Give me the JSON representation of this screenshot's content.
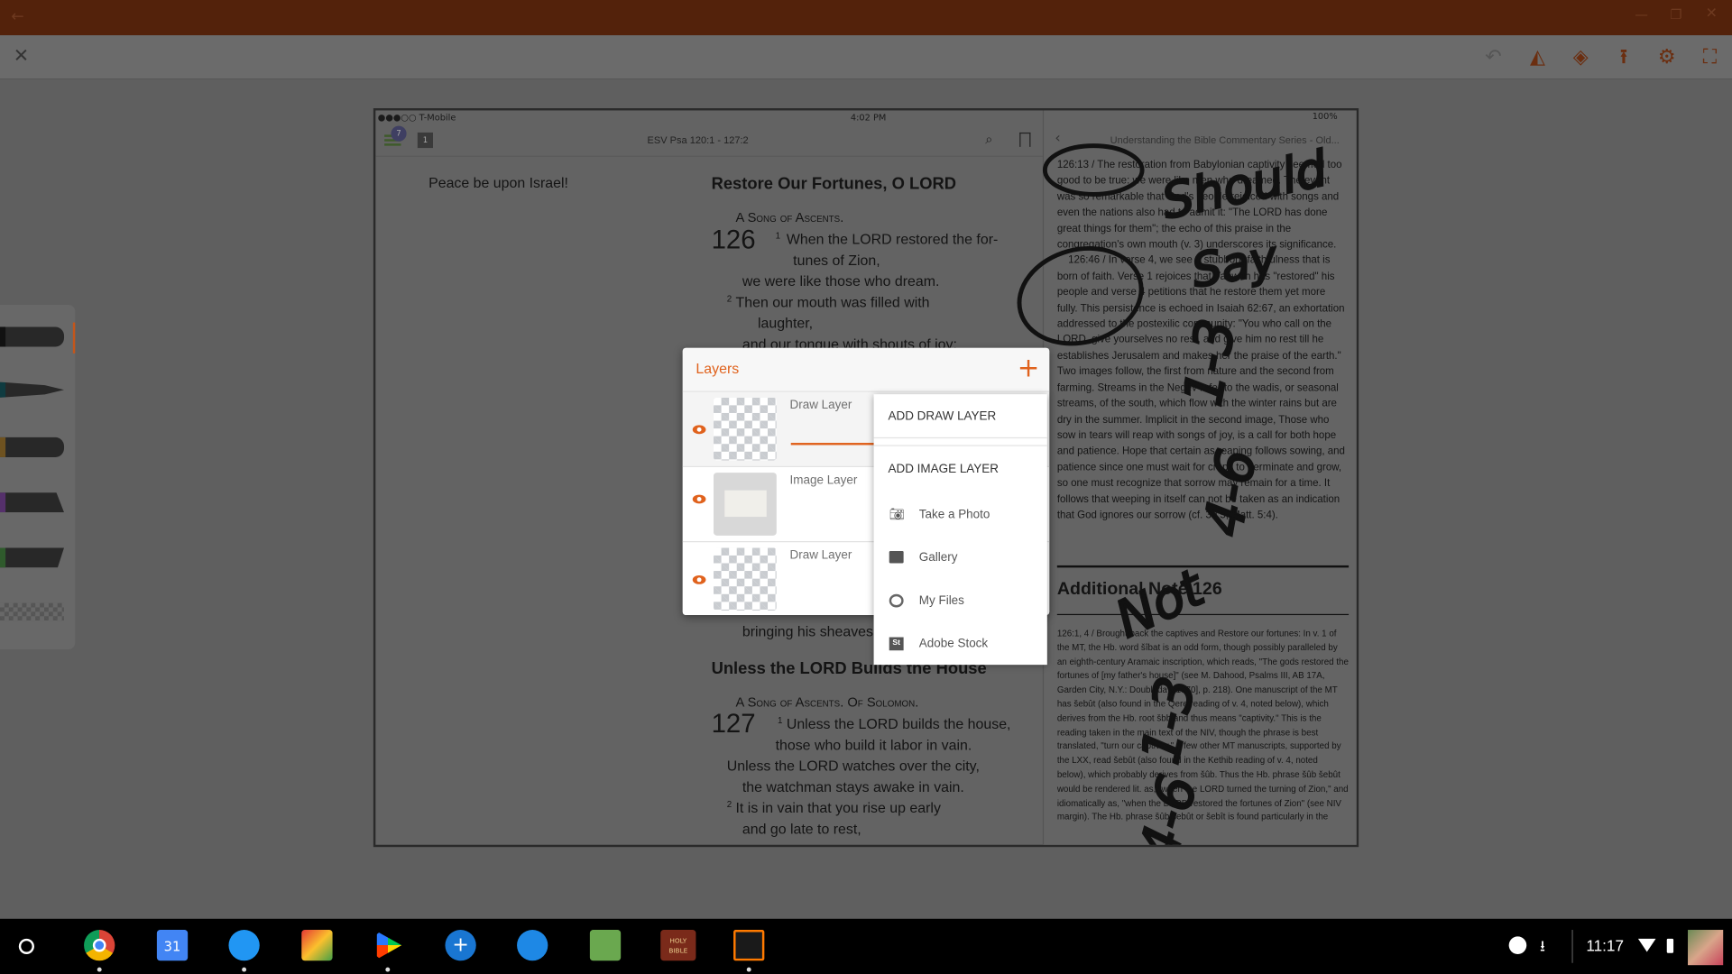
{
  "colors": {
    "accent": "#e0621d",
    "titlebar": "#53220b",
    "toolbar_icons": "#6b2e10",
    "taskbar": "#000000"
  },
  "titlebar": {
    "back_icon": "arrow-left",
    "controls": [
      "minimize",
      "restore",
      "close"
    ]
  },
  "toolbar": {
    "close_icon": "close",
    "icons": [
      "undo",
      "shapes",
      "layers",
      "upload",
      "settings",
      "fullscreen"
    ]
  },
  "screenshot": {
    "status": {
      "carrier": "●●●○○ T-Mobile",
      "time": "4:02 PM",
      "battery": "100%"
    },
    "left_header": {
      "badge": "7",
      "tab_number": "1",
      "reference": "ESV Psa 120:1 - 127:2"
    },
    "right_header": {
      "title": "Understanding the Bible Commentary Series - Old..."
    },
    "bible": {
      "prev_line": "Peace be upon Israel!",
      "heading1": "Restore Our Fortunes, O LORD",
      "song1": "A Song of Ascents.",
      "chapter1": "126",
      "lines1": [
        "When the LORD restored the for-",
        "tunes of Zion,",
        "we were like those who dream.",
        "Then our mouth was filled with",
        "laughter,",
        "and our tongue with shouts of joy;"
      ],
      "verse_nums1": [
        "1",
        "2"
      ],
      "line_bringing": "bringing his sheaves with him.",
      "heading2": "Unless the LORD Builds the House",
      "song2": "A Song of Ascents. Of Solomon.",
      "chapter2": "127",
      "lines2": [
        "Unless the LORD builds the house,",
        "those who build it labor in vain.",
        "Unless the LORD watches over the city,",
        "the watchman stays awake in vain.",
        "It is in vain that you rise up early",
        "and go late to rest,"
      ],
      "verse_nums2": [
        "1",
        "2"
      ]
    },
    "commentary": {
      "para1": "126:13 / The restoration from Babylonian captivity seemed too good to be true: we were like men who dreamed. The event was so remarkable that God's people rejoiced with songs and even the nations also had to admit it: \"The LORD has done great things for them\"; the echo of this praise in the congregation's own mouth (v. 3) underscores its significance.",
      "para2": "126:46 / In verse 4, we see a stubborn faithfulness that is born of faith. Verse 1 rejoices that Yahweh has \"restored\" his people and verse 4 petitions that he restore them yet more fully. This persistence is echoed in Isaiah 62:67, an exhortation addressed to the postexilic community: \"You who call on the LORD, give yourselves no rest, and give him no rest till he establishes Jerusalem and makes her the praise of the earth.\" Two images follow, the first from nature and the second from farming. Streams in the Negev refer to the wadis, or seasonal streams, of the south, which flow with the winter rains but are dry in the summer. Implicit in the second image, Those who sow in tears will reap with songs of joy, is a call for both hope and patience. Hope that certain as reaping follows sowing, and patience since one must wait for crops to germinate and grow, so one must recognize that sorrow may remain for a time. It follows that weeping in itself can not be taken as an indication that God ignores our sorrow (cf. 30:5; Matt. 5:4).",
      "note_heading": "Additional Note 126",
      "note": "126:1, 4 / Brought back the captives and Restore our fortunes: In v. 1 of the MT, the Hb. word šîbat is an odd form, though possibly paralleled by an eighth-century Aramaic inscription, which reads, \"The gods restored the fortunes of [my father's house]\" (see M. Dahood, Psalms III, AB 17A, Garden City, N.Y.: Doubleday, 1970], p. 218). One manuscript of the MT has šebût (also found in the Qere reading of v. 4, noted below), which derives from the Hb. root šbb and thus means \"captivity.\" This is the reading taken in the main text of the NIV, though the phrase is best translated, \"turn our captivity.\" A few other MT manuscripts, supported by the LXX, read šebût (also found in the Kethib reading of v. 4, noted below), which probably derives from šûb. Thus the Hb. phrase šûb šebût would be rendered lit. as, \"when the LORD turned the turning of Zion,\" and idiomatically as, \"when the LORD restored the fortunes of Zion\" (see NIV margin). The Hb. phrase šûb šebût or šebît is found particularly in the"
    },
    "handwriting": [
      "Should",
      "Say",
      "1-3",
      "4-6",
      "Not",
      "1-3",
      "4-6"
    ]
  },
  "brush_colors": [
    "#111111",
    "#0f3b40",
    "#6e5220",
    "#55306b",
    "#2f5a2c"
  ],
  "layers_panel": {
    "title": "Layers",
    "add_icon": "plus",
    "layers": [
      {
        "name": "Draw Layer",
        "visible": true,
        "selected": true
      },
      {
        "name": "Image Layer",
        "visible": true,
        "selected": false
      },
      {
        "name": "Draw Layer",
        "visible": true,
        "selected": false
      }
    ]
  },
  "add_menu": {
    "add_draw": "ADD DRAW LAYER",
    "add_image": "ADD IMAGE LAYER",
    "items": [
      {
        "label": "Take a Photo",
        "icon": "camera"
      },
      {
        "label": "Gallery",
        "icon": "gallery"
      },
      {
        "label": "My Files",
        "icon": "creative-cloud"
      },
      {
        "label": "Adobe Stock",
        "icon": "adobe-stock",
        "glyph": "St"
      }
    ]
  },
  "taskbar": {
    "apps": [
      "Launcher",
      "Chrome",
      "Calendar",
      "Files",
      "Slides",
      "Play Store",
      "Add",
      "Bookmark",
      "Bible Study",
      "Holy Bible",
      "Adobe Draw"
    ],
    "calendar_day": "31",
    "bible_label": "HOLY BIBLE",
    "time": "11:17"
  }
}
